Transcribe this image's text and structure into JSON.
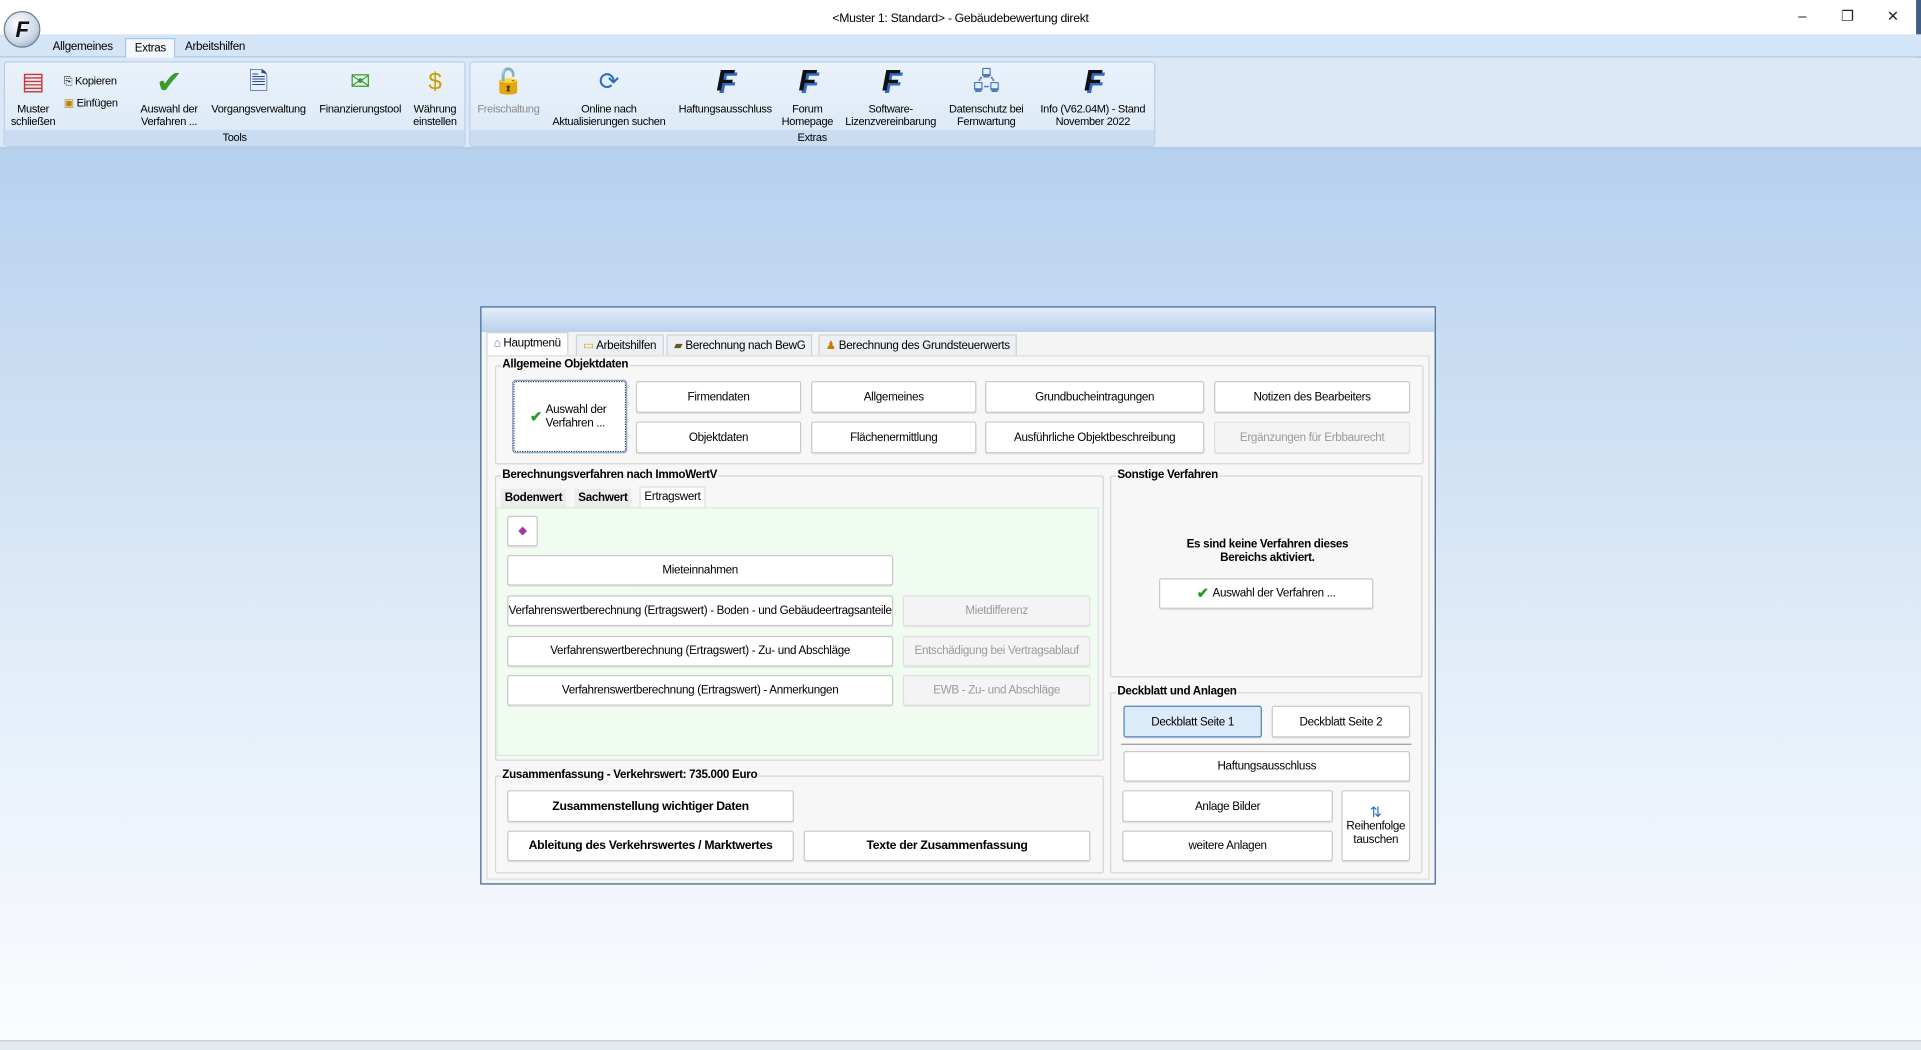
{
  "window": {
    "title": "<Muster 1: Standard> - Gebäudebewertung direkt",
    "controls": {
      "minimize": "–",
      "maximize": "❐",
      "close": "✕"
    }
  },
  "ribbon_tabs": [
    "Allgemeines",
    "Extras",
    "Arbeitshilfen"
  ],
  "ribbon_selected_tab": "Extras",
  "ribbon": {
    "tools": {
      "label": "Tools",
      "items": [
        "Muster schließen",
        "Kopieren",
        "Einfügen",
        "Auswahl der Verfahren ...",
        "Vorgangsverwaltung",
        "Finanzierungstool",
        "Währung einstellen"
      ]
    },
    "extras": {
      "label": "Extras",
      "items": [
        "Freischaltung",
        "Online nach Aktualisierungen suchen",
        "Haftungsausschluss",
        "Forum Homepage",
        "Software-Lizenzvereinbarung",
        "Datenschutz bei Fernwartung",
        "Info (V62.04M) - Stand November 2022"
      ]
    }
  },
  "dialog": {
    "tabs": [
      "Hauptmenü",
      "Arbeitshilfen",
      "Berechnung nach BewG",
      "Berechnung des Grundsteuerwerts"
    ],
    "allgemeine": {
      "title": "Allgemeine Objektdaten",
      "auswahl": "Auswahl der Verfahren ...",
      "buttons": [
        "Firmendaten",
        "Allgemeines",
        "Grundbucheintragungen",
        "Notizen des Bearbeiters",
        "Objektdaten",
        "Flächenermittlung",
        "Ausführliche Objektbeschreibung",
        "Ergänzungen für Erbbaurecht"
      ]
    },
    "berechnung": {
      "title": "Berechnungsverfahren nach ImmoWertV",
      "subtabs": [
        "Bodenwert",
        "Sachwert",
        "Ertragswert"
      ],
      "selected": "Ertragswert",
      "buttons": [
        "Mieteinnahmen",
        "Verfahrenswertberechnung (Ertragswert) - Boden - und Gebäudeertragsanteile",
        "Verfahrenswertberechnung (Ertragswert) - Zu- und Abschläge",
        "Verfahrenswertberechnung (Ertragswert) - Anmerkungen"
      ],
      "disabled": [
        "Mietdifferenz",
        "Entschädigung bei Vertragsablauf",
        "EWB - Zu- und Abschläge"
      ]
    },
    "sonstige": {
      "title": "Sonstige Verfahren",
      "message": "Es sind keine Verfahren dieses Bereichs aktiviert.",
      "button": "Auswahl der Verfahren ..."
    },
    "deckblatt": {
      "title": "Deckblatt und Anlagen",
      "buttons": [
        "Deckblatt Seite 1",
        "Deckblatt Seite 2",
        "Haftungsausschluss",
        "Anlage Bilder",
        "weitere Anlagen",
        "Reihenfolge tauschen"
      ]
    },
    "zusammenfassung": {
      "title": "Zusammenfassung - Verkehrswert: 735.000 Euro",
      "buttons": [
        "Zusammenstellung wichtiger Daten",
        "Ableitung des Verkehrswertes / Marktwertes",
        "Texte der Zusammenfassung"
      ]
    }
  }
}
